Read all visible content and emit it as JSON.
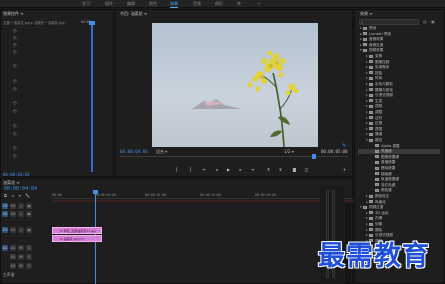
{
  "topbar": {
    "workspaces": [
      {
        "label": "学习",
        "active": false
      },
      {
        "label": "组件",
        "active": false
      },
      {
        "label": "编辑",
        "active": false
      },
      {
        "label": "颜色",
        "active": false
      },
      {
        "label": "效果",
        "active": true
      },
      {
        "label": "音频",
        "active": false
      },
      {
        "label": "图形",
        "active": false
      },
      {
        "label": "库",
        "active": false
      }
    ]
  },
  "source_panel": {
    "tab": "效果控件 ≡",
    "header": "主要 * 油菜花.jpg ▸ 油菜花 * 油菜花.jpg",
    "timecode": "00:00",
    "footer_timecode": "00:00:04:04"
  },
  "program_panel": {
    "tab": "节目: 油菜花 ≡",
    "timecode_current": "00:00:04:04",
    "fit_label": "适合",
    "page_label": "1/2",
    "timecode_total": "00:00:05:00"
  },
  "effects_panel": {
    "tab": "效果 ≡",
    "rows": [
      {
        "label": "预设",
        "level": 0,
        "expanded": false
      },
      {
        "label": "Lumetri 预设",
        "level": 0,
        "expanded": false
      },
      {
        "label": "音频效果",
        "level": 0,
        "expanded": false
      },
      {
        "label": "音频过渡",
        "level": 0,
        "expanded": false
      },
      {
        "label": "视频效果",
        "level": 0,
        "expanded": true
      },
      {
        "label": "变换",
        "level": 1,
        "expanded": false
      },
      {
        "label": "图像控制",
        "level": 1,
        "expanded": false
      },
      {
        "label": "实用程序",
        "level": 1,
        "expanded": false
      },
      {
        "label": "扭曲",
        "level": 1,
        "expanded": false
      },
      {
        "label": "时间",
        "level": 1,
        "expanded": false
      },
      {
        "label": "杂色与颗粒",
        "level": 1,
        "expanded": false
      },
      {
        "label": "模糊与锐化",
        "level": 1,
        "expanded": false
      },
      {
        "label": "沉浸式视频",
        "level": 1,
        "expanded": false
      },
      {
        "label": "生成",
        "level": 1,
        "expanded": false
      },
      {
        "label": "视频",
        "level": 1,
        "expanded": false
      },
      {
        "label": "调整",
        "level": 1,
        "expanded": false
      },
      {
        "label": "过时",
        "level": 1,
        "expanded": false
      },
      {
        "label": "过渡",
        "level": 1,
        "expanded": false
      },
      {
        "label": "透视",
        "level": 1,
        "expanded": false
      },
      {
        "label": "通道",
        "level": 1,
        "expanded": false
      },
      {
        "label": "键控",
        "level": 1,
        "expanded": true
      },
      {
        "label": "Alpha 调整",
        "level": 2,
        "expanded": false
      },
      {
        "label": "亮度键",
        "level": 2,
        "expanded": false,
        "selected": true
      },
      {
        "label": "图像遮罩键",
        "level": 2,
        "expanded": false
      },
      {
        "label": "差值遮罩",
        "level": 2,
        "expanded": false
      },
      {
        "label": "移除遮罩",
        "level": 2,
        "expanded": false
      },
      {
        "label": "超级键",
        "level": 2,
        "expanded": false
      },
      {
        "label": "轨道遮罩键",
        "level": 2,
        "expanded": false
      },
      {
        "label": "非红色键",
        "level": 2,
        "expanded": false
      },
      {
        "label": "颜色键",
        "level": 2,
        "expanded": false
      },
      {
        "label": "颜色校正",
        "level": 1,
        "expanded": false
      },
      {
        "label": "风格化",
        "level": 1,
        "expanded": false
      },
      {
        "label": "视频过渡",
        "level": 0,
        "expanded": true
      },
      {
        "label": "3D 运动",
        "level": 1,
        "expanded": false
      },
      {
        "label": "内滑",
        "level": 1,
        "expanded": false
      },
      {
        "label": "划像",
        "level": 1,
        "expanded": false
      },
      {
        "label": "擦除",
        "level": 1,
        "expanded": false
      },
      {
        "label": "沉浸式视频",
        "level": 1,
        "expanded": false
      },
      {
        "label": "溶解",
        "level": 1,
        "expanded": false
      },
      {
        "label": "缩放",
        "level": 1,
        "expanded": false
      },
      {
        "label": "页面剥落",
        "level": 1,
        "expanded": false
      }
    ],
    "footer": "Lumetri 颜色"
  },
  "timeline": {
    "tab": "油菜花 ≡",
    "timecode": "00:00:04:04",
    "ruler": [
      "00:00",
      "00:00:05:00",
      "00:00:10:00",
      "00:00:15:00",
      "00:00:20:00"
    ],
    "tracks": [
      {
        "name": "V3",
        "type": "video"
      },
      {
        "name": "V2",
        "type": "video"
      },
      {
        "name": "V1",
        "type": "video"
      },
      {
        "name": "A1",
        "type": "audio"
      },
      {
        "name": "A2",
        "type": "audio"
      },
      {
        "name": "A3",
        "type": "audio"
      }
    ],
    "clips": [
      {
        "label": "fx 黄花_宽屏油菜花01.jpg"
      },
      {
        "label": "fx 油菜花.jpg [V]"
      }
    ],
    "master_label": "主声道"
  },
  "watermark": "最需教育",
  "colors": {
    "accent": "#3f8fe8",
    "clip_pink": "#d680d4",
    "panel_bg": "#1e1e1e"
  }
}
